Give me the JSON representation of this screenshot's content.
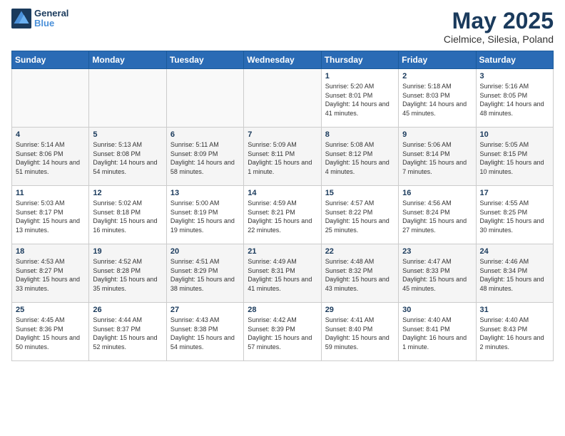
{
  "logo": {
    "text_general": "General",
    "text_blue": "Blue"
  },
  "header": {
    "month": "May 2025",
    "location": "Cielmice, Silesia, Poland"
  },
  "weekdays": [
    "Sunday",
    "Monday",
    "Tuesday",
    "Wednesday",
    "Thursday",
    "Friday",
    "Saturday"
  ],
  "weeks": [
    [
      {
        "day": "",
        "sunrise": "",
        "sunset": "",
        "daylight": ""
      },
      {
        "day": "",
        "sunrise": "",
        "sunset": "",
        "daylight": ""
      },
      {
        "day": "",
        "sunrise": "",
        "sunset": "",
        "daylight": ""
      },
      {
        "day": "",
        "sunrise": "",
        "sunset": "",
        "daylight": ""
      },
      {
        "day": "1",
        "sunrise": "Sunrise: 5:20 AM",
        "sunset": "Sunset: 8:01 PM",
        "daylight": "Daylight: 14 hours and 41 minutes."
      },
      {
        "day": "2",
        "sunrise": "Sunrise: 5:18 AM",
        "sunset": "Sunset: 8:03 PM",
        "daylight": "Daylight: 14 hours and 45 minutes."
      },
      {
        "day": "3",
        "sunrise": "Sunrise: 5:16 AM",
        "sunset": "Sunset: 8:05 PM",
        "daylight": "Daylight: 14 hours and 48 minutes."
      }
    ],
    [
      {
        "day": "4",
        "sunrise": "Sunrise: 5:14 AM",
        "sunset": "Sunset: 8:06 PM",
        "daylight": "Daylight: 14 hours and 51 minutes."
      },
      {
        "day": "5",
        "sunrise": "Sunrise: 5:13 AM",
        "sunset": "Sunset: 8:08 PM",
        "daylight": "Daylight: 14 hours and 54 minutes."
      },
      {
        "day": "6",
        "sunrise": "Sunrise: 5:11 AM",
        "sunset": "Sunset: 8:09 PM",
        "daylight": "Daylight: 14 hours and 58 minutes."
      },
      {
        "day": "7",
        "sunrise": "Sunrise: 5:09 AM",
        "sunset": "Sunset: 8:11 PM",
        "daylight": "Daylight: 15 hours and 1 minute."
      },
      {
        "day": "8",
        "sunrise": "Sunrise: 5:08 AM",
        "sunset": "Sunset: 8:12 PM",
        "daylight": "Daylight: 15 hours and 4 minutes."
      },
      {
        "day": "9",
        "sunrise": "Sunrise: 5:06 AM",
        "sunset": "Sunset: 8:14 PM",
        "daylight": "Daylight: 15 hours and 7 minutes."
      },
      {
        "day": "10",
        "sunrise": "Sunrise: 5:05 AM",
        "sunset": "Sunset: 8:15 PM",
        "daylight": "Daylight: 15 hours and 10 minutes."
      }
    ],
    [
      {
        "day": "11",
        "sunrise": "Sunrise: 5:03 AM",
        "sunset": "Sunset: 8:17 PM",
        "daylight": "Daylight: 15 hours and 13 minutes."
      },
      {
        "day": "12",
        "sunrise": "Sunrise: 5:02 AM",
        "sunset": "Sunset: 8:18 PM",
        "daylight": "Daylight: 15 hours and 16 minutes."
      },
      {
        "day": "13",
        "sunrise": "Sunrise: 5:00 AM",
        "sunset": "Sunset: 8:19 PM",
        "daylight": "Daylight: 15 hours and 19 minutes."
      },
      {
        "day": "14",
        "sunrise": "Sunrise: 4:59 AM",
        "sunset": "Sunset: 8:21 PM",
        "daylight": "Daylight: 15 hours and 22 minutes."
      },
      {
        "day": "15",
        "sunrise": "Sunrise: 4:57 AM",
        "sunset": "Sunset: 8:22 PM",
        "daylight": "Daylight: 15 hours and 25 minutes."
      },
      {
        "day": "16",
        "sunrise": "Sunrise: 4:56 AM",
        "sunset": "Sunset: 8:24 PM",
        "daylight": "Daylight: 15 hours and 27 minutes."
      },
      {
        "day": "17",
        "sunrise": "Sunrise: 4:55 AM",
        "sunset": "Sunset: 8:25 PM",
        "daylight": "Daylight: 15 hours and 30 minutes."
      }
    ],
    [
      {
        "day": "18",
        "sunrise": "Sunrise: 4:53 AM",
        "sunset": "Sunset: 8:27 PM",
        "daylight": "Daylight: 15 hours and 33 minutes."
      },
      {
        "day": "19",
        "sunrise": "Sunrise: 4:52 AM",
        "sunset": "Sunset: 8:28 PM",
        "daylight": "Daylight: 15 hours and 35 minutes."
      },
      {
        "day": "20",
        "sunrise": "Sunrise: 4:51 AM",
        "sunset": "Sunset: 8:29 PM",
        "daylight": "Daylight: 15 hours and 38 minutes."
      },
      {
        "day": "21",
        "sunrise": "Sunrise: 4:49 AM",
        "sunset": "Sunset: 8:31 PM",
        "daylight": "Daylight: 15 hours and 41 minutes."
      },
      {
        "day": "22",
        "sunrise": "Sunrise: 4:48 AM",
        "sunset": "Sunset: 8:32 PM",
        "daylight": "Daylight: 15 hours and 43 minutes."
      },
      {
        "day": "23",
        "sunrise": "Sunrise: 4:47 AM",
        "sunset": "Sunset: 8:33 PM",
        "daylight": "Daylight: 15 hours and 45 minutes."
      },
      {
        "day": "24",
        "sunrise": "Sunrise: 4:46 AM",
        "sunset": "Sunset: 8:34 PM",
        "daylight": "Daylight: 15 hours and 48 minutes."
      }
    ],
    [
      {
        "day": "25",
        "sunrise": "Sunrise: 4:45 AM",
        "sunset": "Sunset: 8:36 PM",
        "daylight": "Daylight: 15 hours and 50 minutes."
      },
      {
        "day": "26",
        "sunrise": "Sunrise: 4:44 AM",
        "sunset": "Sunset: 8:37 PM",
        "daylight": "Daylight: 15 hours and 52 minutes."
      },
      {
        "day": "27",
        "sunrise": "Sunrise: 4:43 AM",
        "sunset": "Sunset: 8:38 PM",
        "daylight": "Daylight: 15 hours and 54 minutes."
      },
      {
        "day": "28",
        "sunrise": "Sunrise: 4:42 AM",
        "sunset": "Sunset: 8:39 PM",
        "daylight": "Daylight: 15 hours and 57 minutes."
      },
      {
        "day": "29",
        "sunrise": "Sunrise: 4:41 AM",
        "sunset": "Sunset: 8:40 PM",
        "daylight": "Daylight: 15 hours and 59 minutes."
      },
      {
        "day": "30",
        "sunrise": "Sunrise: 4:40 AM",
        "sunset": "Sunset: 8:41 PM",
        "daylight": "Daylight: 16 hours and 1 minute."
      },
      {
        "day": "31",
        "sunrise": "Sunrise: 4:40 AM",
        "sunset": "Sunset: 8:43 PM",
        "daylight": "Daylight: 16 hours and 2 minutes."
      }
    ]
  ]
}
